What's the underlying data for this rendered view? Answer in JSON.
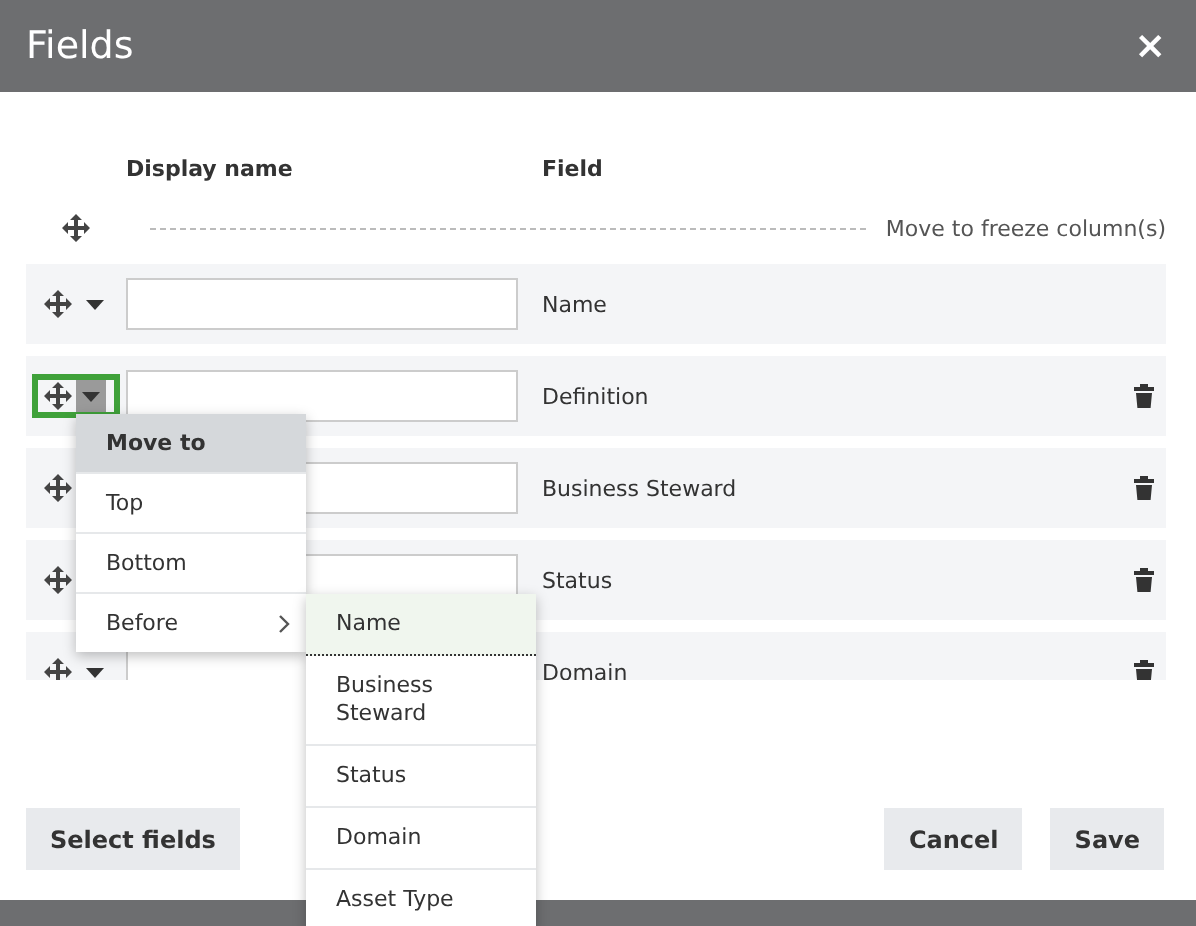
{
  "window": {
    "title": "Fields",
    "close": "×"
  },
  "columns": [
    "Display name",
    "Field"
  ],
  "freeze_row": {
    "label": "Move to freeze column(s)"
  },
  "rows": [
    {
      "field": "Name",
      "caret": true,
      "deletable": false,
      "focused": false
    },
    {
      "field": "Definition",
      "caret": true,
      "deletable": true,
      "focused": true
    },
    {
      "field": "Business Steward",
      "caret": false,
      "deletable": true,
      "focused": false
    },
    {
      "field": "Status",
      "caret": false,
      "deletable": true,
      "focused": false
    },
    {
      "field": "Domain",
      "caret": true,
      "deletable": true,
      "focused": false
    }
  ],
  "menu": {
    "header": "Move to",
    "items": [
      {
        "label": "Top",
        "submenu": false
      },
      {
        "label": "Bottom",
        "submenu": false
      },
      {
        "label": "Before",
        "submenu": true
      }
    ]
  },
  "submenu": {
    "items": [
      {
        "label": "Name",
        "selected": true
      },
      {
        "label": "Business Steward",
        "selected": false
      },
      {
        "label": "Status",
        "selected": false
      },
      {
        "label": "Domain",
        "selected": false
      },
      {
        "label": "Asset Type",
        "selected": false
      }
    ]
  },
  "buttons": {
    "left": [
      "Select fields"
    ],
    "right": [
      "Cancel",
      "Save"
    ]
  }
}
